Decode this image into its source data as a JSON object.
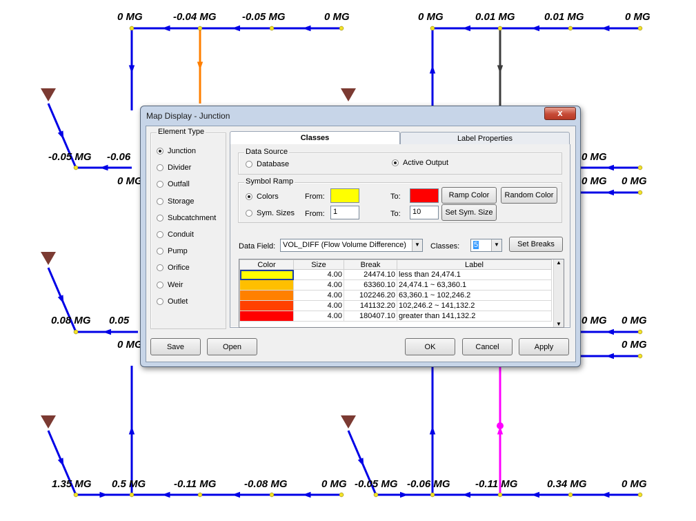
{
  "map": {
    "labels": [
      {
        "text": "0 MG"
      },
      {
        "text": "-0.04 MG"
      },
      {
        "text": "-0.05 MG"
      },
      {
        "text": "0 MG"
      },
      {
        "text": "0 MG"
      },
      {
        "text": "0.01 MG"
      },
      {
        "text": "0.01 MG"
      },
      {
        "text": "0 MG"
      },
      {
        "text": "-0.05 MG"
      },
      {
        "text": "-0.06"
      },
      {
        "text": "0 MG"
      },
      {
        "text": "0 MG"
      },
      {
        "text": "0 MG"
      },
      {
        "text": "0 MG"
      },
      {
        "text": "0.08 MG"
      },
      {
        "text": "0.05"
      },
      {
        "text": "0 MG"
      },
      {
        "text": "0 MG"
      },
      {
        "text": "0 MG"
      },
      {
        "text": "0 MG"
      },
      {
        "text": "1.35 MG"
      },
      {
        "text": "0.5 MG"
      },
      {
        "text": "-0.11 MG"
      },
      {
        "text": "-0.08 MG"
      },
      {
        "text": "0 MG"
      },
      {
        "text": "-0.05 MG"
      },
      {
        "text": "-0.06 MG"
      },
      {
        "text": "-0.11 MG"
      },
      {
        "text": "0.34 MG"
      },
      {
        "text": "0 MG"
      }
    ],
    "colors": {
      "link": "#0000e6",
      "node": "#f2e22a",
      "outfall": "#7b3a32",
      "orange": "#ff7f00",
      "gray": "#3c3c3c",
      "magenta": "#ff00ff"
    }
  },
  "dialog": {
    "title": "Map Display - Junction",
    "close_label": "x",
    "element_type": {
      "legend": "Element Type",
      "options": [
        "Junction",
        "Divider",
        "Outfall",
        "Storage",
        "Subcatchment",
        "Conduit",
        "Pump",
        "Orifice",
        "Weir",
        "Outlet"
      ],
      "selected": "Junction"
    },
    "tabs": [
      {
        "label": "Classes"
      },
      {
        "label": "Label Properties"
      }
    ],
    "active_tab": "Classes",
    "data_source": {
      "legend": "Data Source",
      "database_label": "Database",
      "active_output_label": "Active Output",
      "selected": "Active Output"
    },
    "symbol_ramp": {
      "legend": "Symbol Ramp",
      "colors_label": "Colors",
      "sizes_label": "Sym. Sizes",
      "from_label": "From:",
      "to_label": "To:",
      "from_color": "#ffff00",
      "to_color": "#ff0000",
      "from_size": "1",
      "to_size": "10",
      "ramp_color_button": "Ramp Color",
      "random_color_button": "Random Color",
      "set_sizes_button": "Set Sym. Size",
      "selected": "Colors"
    },
    "data_field": {
      "label": "Data Field:",
      "value": "VOL_DIFF (Flow Volume Difference)",
      "classes_label": "Classes:",
      "classes_value": "5",
      "set_breaks_button": "Set Breaks"
    },
    "table": {
      "headers": [
        "Color",
        "Size",
        "Break",
        "Label"
      ],
      "rows": [
        {
          "color": "#ffff00",
          "size": "4.00",
          "break": "24474.10",
          "label": "less than 24,474.1"
        },
        {
          "color": "#ffbf00",
          "size": "4.00",
          "break": "63360.10",
          "label": "24,474.1 ~ 63,360.1"
        },
        {
          "color": "#ff8000",
          "size": "4.00",
          "break": "102246.20",
          "label": "63,360.1 ~ 102,246.2"
        },
        {
          "color": "#ff4000",
          "size": "4.00",
          "break": "141132.20",
          "label": "102,246.2 ~ 141,132.2"
        },
        {
          "color": "#ff0000",
          "size": "4.00",
          "break": "180407.10",
          "label": "greater than 141,132.2"
        }
      ]
    },
    "buttons": {
      "save": "Save",
      "open": "Open",
      "ok": "OK",
      "cancel": "Cancel",
      "apply": "Apply"
    }
  }
}
